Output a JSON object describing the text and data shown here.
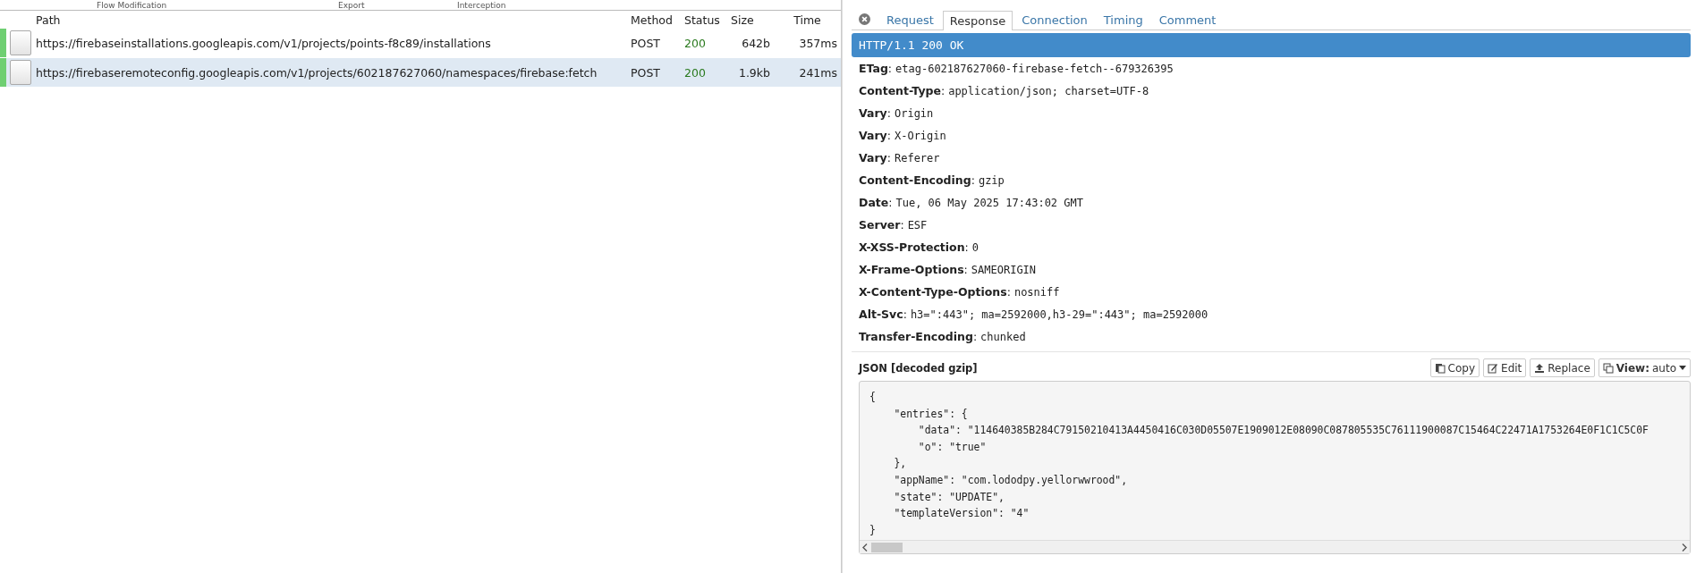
{
  "top_menu": [
    "Flow Modification",
    "Export",
    "Interception"
  ],
  "flows": {
    "columns": [
      "Path",
      "Method",
      "Status",
      "Size",
      "Time"
    ],
    "rows": [
      {
        "path": "https://firebaseinstallations.googleapis.com/v1/projects/points-f8c89/installations",
        "method": "POST",
        "status": "200",
        "size": "642b",
        "time": "357ms",
        "selected": false
      },
      {
        "path": "https://firebaseremoteconfig.googleapis.com/v1/projects/602187627060/namespaces/firebase:fetch",
        "method": "POST",
        "status": "200",
        "size": "1.9kb",
        "time": "241ms",
        "selected": true
      }
    ]
  },
  "detail": {
    "tabs": [
      {
        "label": "Request",
        "selected": false
      },
      {
        "label": "Response",
        "selected": true
      },
      {
        "label": "Connection",
        "selected": false
      },
      {
        "label": "Timing",
        "selected": false
      },
      {
        "label": "Comment",
        "selected": false
      }
    ],
    "status_line": "HTTP/1.1 200 OK",
    "separator": ":",
    "headers": [
      {
        "name": "ETag",
        "value": "etag-602187627060-firebase-fetch--679326395"
      },
      {
        "name": "Content-Type",
        "value": "application/json; charset=UTF-8"
      },
      {
        "name": "Vary",
        "value": "Origin"
      },
      {
        "name": "Vary",
        "value": "X-Origin"
      },
      {
        "name": "Vary",
        "value": "Referer"
      },
      {
        "name": "Content-Encoding",
        "value": "gzip"
      },
      {
        "name": "Date",
        "value": "Tue, 06 May 2025 17:43:02 GMT"
      },
      {
        "name": "Server",
        "value": "ESF"
      },
      {
        "name": "X-XSS-Protection",
        "value": "0"
      },
      {
        "name": "X-Frame-Options",
        "value": "SAMEORIGIN"
      },
      {
        "name": "X-Content-Type-Options",
        "value": "nosniff"
      },
      {
        "name": "Alt-Svc",
        "value": "h3=\":443\"; ma=2592000,h3-29=\":443\"; ma=2592000"
      },
      {
        "name": "Transfer-Encoding",
        "value": "chunked"
      }
    ],
    "body": {
      "title": "JSON [decoded gzip]",
      "buttons": [
        {
          "kind": "copy",
          "label": "Copy"
        },
        {
          "kind": "edit",
          "label": "Edit"
        },
        {
          "kind": "replace",
          "label": "Replace"
        }
      ],
      "view": {
        "label": "View:",
        "value": "auto"
      },
      "code": "{\n    \"entries\": {\n        \"data\": \"114640385B284C79150210413A4450416C030D05507E1909012E08090C087805535C76111900087C15464C22471A1753264E0F1C1C5C0F\n        \"o\": \"true\"\n    },\n    \"appName\": \"com.lododpy.yellorwwrood\",\n    \"state\": \"UPDATE\",\n    \"templateVersion\": \"4\"\n}"
    }
  }
}
